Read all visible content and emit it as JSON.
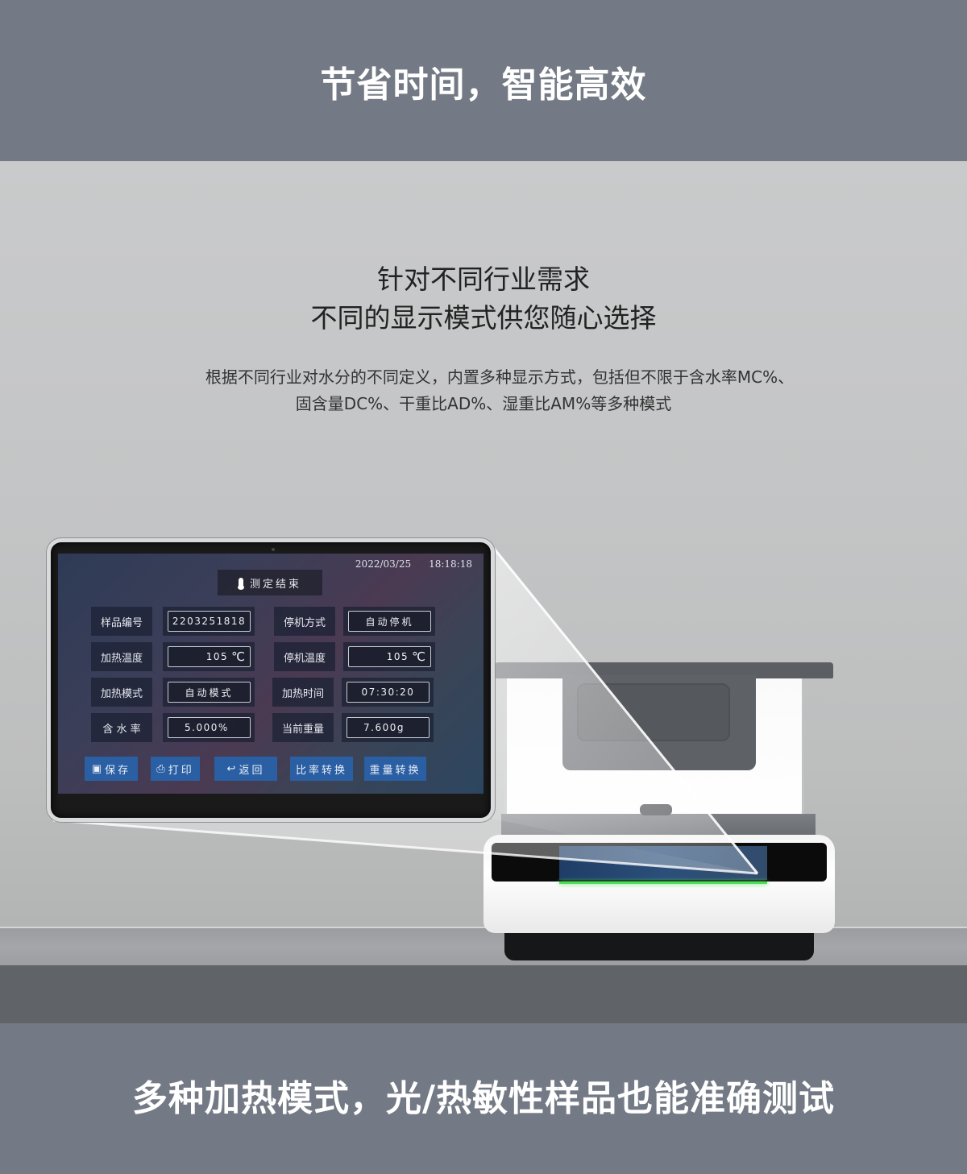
{
  "header": {
    "title": "节省时间，智能高效"
  },
  "hero": {
    "subtitle_line1": "针对不同行业需求",
    "subtitle_line2": "不同的显示模式供您随心选择",
    "description_line1": "根据不同行业对水分的不同定义，内置多种显示方式，包括但不限于含水率MC%、",
    "description_line2": "固含量DC%、干重比AD%、湿重比AM%等多种模式"
  },
  "screen": {
    "date": "2022/03/25",
    "time": "18:18:18",
    "status": "测定结束",
    "status_icon": "thermometer-icon",
    "fields": [
      {
        "label": "样品编号",
        "value": "2203251818",
        "unit": ""
      },
      {
        "label": "停机方式",
        "value": "自动停机",
        "unit": ""
      },
      {
        "label": "加热温度",
        "value": "105",
        "unit": "℃"
      },
      {
        "label": "停机温度",
        "value": "105",
        "unit": "℃"
      },
      {
        "label": "加热模式",
        "value": "自动模式",
        "unit": ""
      },
      {
        "label": "加热时间",
        "value": "07:30:20",
        "unit": ""
      },
      {
        "label": "含 水 率",
        "value": "5.000%",
        "unit": ""
      },
      {
        "label": "当前重量",
        "value": "7.600g",
        "unit": ""
      }
    ],
    "buttons": [
      {
        "label": "保存",
        "icon": "save-icon"
      },
      {
        "label": "打印",
        "icon": "printer-icon"
      },
      {
        "label": "返回",
        "icon": "back-arrow-icon"
      },
      {
        "label": "比率转换",
        "icon": ""
      },
      {
        "label": "重量转换",
        "icon": ""
      }
    ]
  },
  "footer": {
    "title": "多种加热模式，光/热敏性样品也能准确测试"
  },
  "colors": {
    "band": "#747a85",
    "button": "#2a5fa3",
    "indicator": "#4fdc5a"
  }
}
